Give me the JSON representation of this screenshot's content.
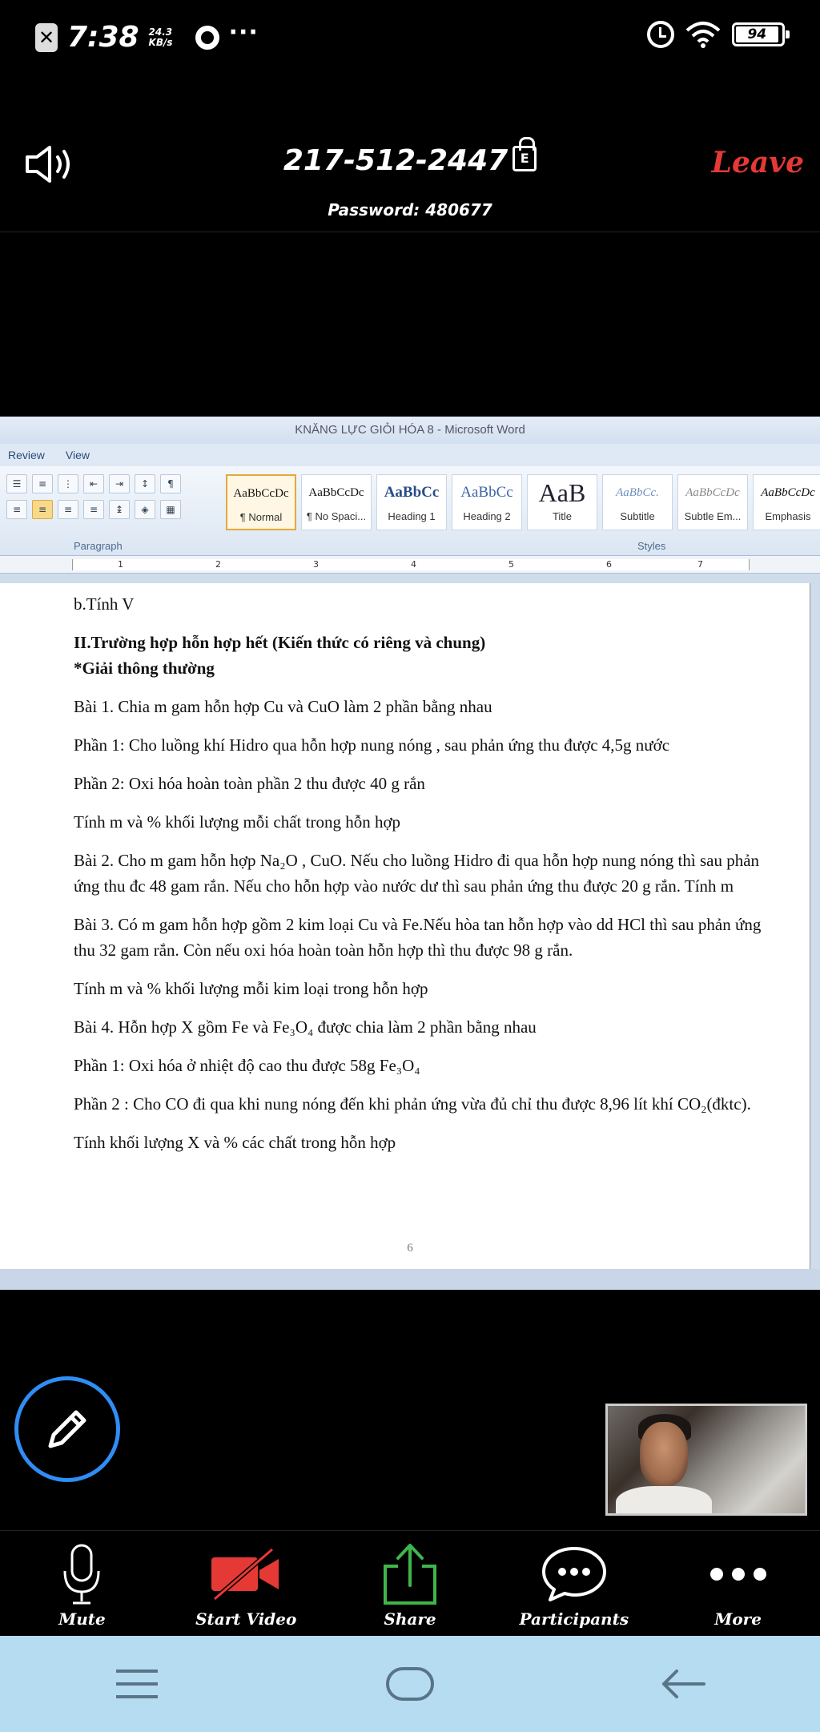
{
  "status": {
    "time": "7:38",
    "speed_value": "24.3",
    "speed_unit": "KB/s",
    "battery": "94"
  },
  "meeting": {
    "id": "217-512-2447",
    "lock_letter": "E",
    "password": "Password: 480677",
    "leave_label": "Leave"
  },
  "word": {
    "title": "KNĂNG LỰC GIỎI HÓA 8 - Microsoft Word",
    "tabs": [
      "Review",
      "View"
    ],
    "group_paragraph": "Paragraph",
    "group_styles": "Styles",
    "styles": [
      {
        "preview": "AaBbCcDc",
        "name": "¶ Normal"
      },
      {
        "preview": "AaBbCcDc",
        "name": "¶ No Spaci..."
      },
      {
        "preview": "AaBbCc",
        "name": "Heading 1"
      },
      {
        "preview": "AaBbCc",
        "name": "Heading 2"
      },
      {
        "preview": "AaB",
        "name": "Title"
      },
      {
        "preview": "AaBbCc.",
        "name": "Subtitle"
      },
      {
        "preview": "AaBbCcDc",
        "name": "Subtle Em..."
      },
      {
        "preview": "AaBbCcDc",
        "name": "Emphasis"
      }
    ],
    "ruler_numbers": [
      "1",
      "2",
      "3",
      "4",
      "5",
      "6",
      "7"
    ],
    "page_number": "6",
    "doc": {
      "l1": "b.Tính V",
      "l2": "II.Trường hợp hỗn hợp hết (Kiến thức có riêng và chung)",
      "l3": "*Giải thông thường",
      "l4": "Bài 1. Chia  m gam hỗn hợp Cu và CuO làm 2 phần bằng nhau",
      "l5": "Phần 1: Cho luồng khí Hidro qua hỗn hợp nung nóng , sau phản ứng thu được 4,5g nước",
      "l6": "Phần 2: Oxi hóa hoàn toàn phần 2 thu được 40 g rắn",
      "l7": " Tính m và % khối lượng mỗi chất trong hỗn hợp",
      "l8": "Bài 2. Cho m gam hỗn hợp Na₂O , CuO. Nếu cho luồng Hidro đi qua hỗn hợp nung nóng thì sau phản ứng thu đc 48 gam rắn. Nếu cho hỗn hợp vào nước dư thì sau phản ứng thu được 20 g rắn. Tính m",
      "l9": "Bài 3. Có m gam hỗn hợp gồm 2 kim loại Cu và Fe.Nếu hòa tan hỗn hợp vào dd HCl thì sau phản ứng thu 32 gam rắn. Còn nếu oxi hóa hoàn toàn hỗn hợp thì thu được 98 g rắn.",
      "l10": "Tính m và % khối lượng mỗi kim loại trong hỗn hợp",
      "l11": "Bài 4. Hỗn hợp X gồm Fe và Fe₃O₄ được chia làm 2 phần bằng nhau",
      "l12": "Phần 1: Oxi hóa ở nhiệt độ cao thu được 58g Fe₃O₄",
      "l13": "Phần 2 : Cho CO đi qua khi nung nóng đến khi phản ứng vừa đủ chỉ thu được 8,96 lít khí CO₂(đktc).",
      "l14": "Tính khối lượng X và % các chất trong hỗn hợp"
    }
  },
  "toolbar": {
    "mute": "Mute",
    "start_video": "Start Video",
    "share": "Share",
    "participants": "Participants",
    "more": "More"
  },
  "colors": {
    "leave": "#e53935",
    "annotate_ring": "#2f8df5",
    "share_green": "#3fb54a",
    "video_red": "#e53935",
    "navbar": "#b6dcf2"
  }
}
